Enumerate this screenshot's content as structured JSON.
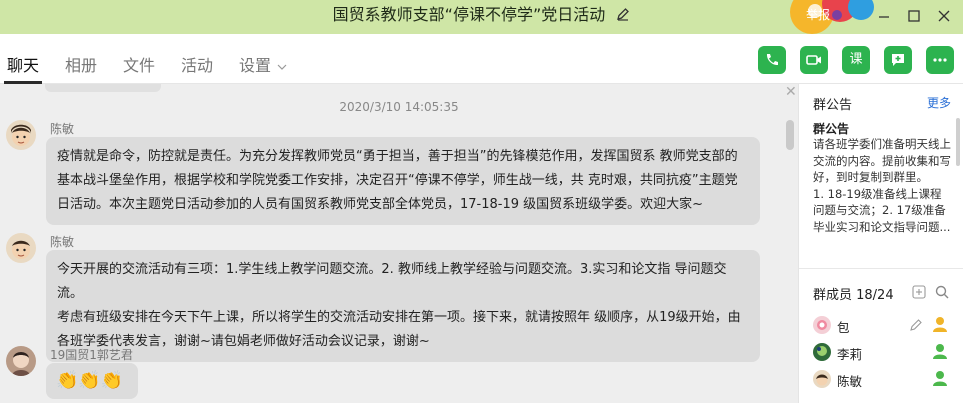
{
  "window": {
    "title": "国贸系教师支部“停课不停学”党日活动",
    "report_label": "举报"
  },
  "tabs": [
    {
      "label": "聊天"
    },
    {
      "label": "相册"
    },
    {
      "label": "文件"
    },
    {
      "label": "活动"
    },
    {
      "label": "设置"
    }
  ],
  "toolbar": {
    "call_icon": "phone-icon",
    "video_icon": "video-icon",
    "class_label": "课",
    "share_icon": "add-chat-icon",
    "more_icon": "more-icon"
  },
  "chat": {
    "timestamp": "2020/3/10 14:05:35",
    "messages": [
      {
        "sender": "陈敏",
        "lines": [
          "疫情就是命令，防控就是责任。为充分发挥教师党员“勇于担当，善于担当”的先锋模范作用，发挥国贸系 教师党支部的",
          "基本战斗堡垒作用，根据学校和学院党委工作安排，决定召开“停课不停学，师生战一线，共 克时艰，共同抗疫”主题党",
          "日活动。本次主题党日活动参加的人员有国贸系教师党支部全体党员，17-18-19 级国贸系班级学委。欢迎大家~"
        ]
      },
      {
        "sender": "陈敏",
        "lines": [
          "今天开展的交流活动有三项：1.学生线上教学问题交流。2. 教师线上教学经验与问题交流。3.实习和论文指 导问题交流。",
          "考虑有班级安排在今天下午上课，所以将学生的交流活动安排在第一项。接下来，就请按照年 级顺序，从19级开始，由",
          "各班学委代表发言，谢谢~请包娟老师做好活动会议记录，谢谢~"
        ]
      },
      {
        "sender": "19国贸1郭艺君",
        "lines": [
          "👏👏👏"
        ]
      }
    ]
  },
  "panel": {
    "notice_heading": "群公告",
    "more_label": "更多",
    "notice_title": "群公告",
    "notice_lines": [
      "请各班学委们准备明天线上",
      "交流的内容。提前收集和写",
      "好，到时复制到群里。",
      "1. 18-19级准备线上课程",
      "问题与交流；2. 17级准备",
      "毕业实习和论文指导问题..."
    ],
    "members_heading": "群成员 18/24",
    "members": [
      {
        "name": "包"
      },
      {
        "name": "李莉"
      },
      {
        "name": "陈敏"
      }
    ]
  },
  "colors": {
    "titlebar": "#cfe6a6",
    "accent_green": "#2db34f",
    "link_blue": "#2a6fd6"
  }
}
